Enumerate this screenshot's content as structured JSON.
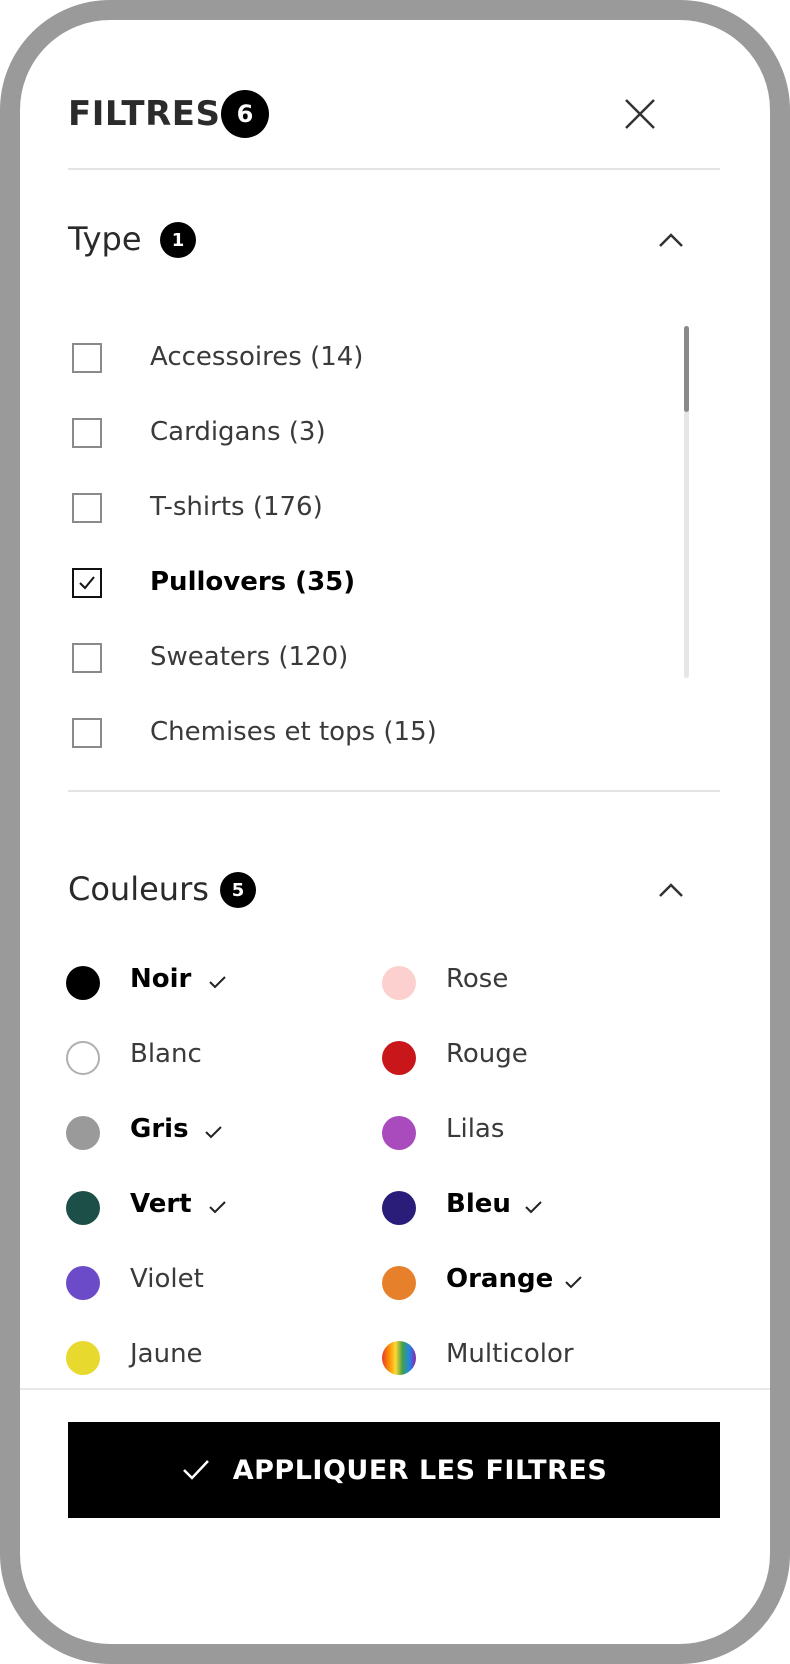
{
  "header": {
    "title": "FILTRES",
    "count": "6"
  },
  "type_section": {
    "title": "Type",
    "count": "1",
    "items": [
      {
        "label": "Accessoires (14)",
        "checked": false
      },
      {
        "label": "Cardigans (3)",
        "checked": false
      },
      {
        "label": "T-shirts (176)",
        "checked": false
      },
      {
        "label": "Pullovers (35)",
        "checked": true
      },
      {
        "label": "Sweaters (120)",
        "checked": false
      },
      {
        "label": "Chemises et tops (15)",
        "checked": false
      }
    ]
  },
  "colors_section": {
    "title": "Couleurs",
    "count": "5",
    "items": [
      {
        "label": "Noir",
        "color": "#000000",
        "selected": true
      },
      {
        "label": "Rose",
        "color": "#fdd0d0",
        "selected": false
      },
      {
        "label": "Blanc",
        "color": "#ffffff",
        "selected": false
      },
      {
        "label": "Rouge",
        "color": "#c8161b",
        "selected": false
      },
      {
        "label": "Gris",
        "color": "#9a9a9a",
        "selected": true
      },
      {
        "label": "Lilas",
        "color": "#a94bbd",
        "selected": false
      },
      {
        "label": "Vert",
        "color": "#1c4f48",
        "selected": true
      },
      {
        "label": "Bleu",
        "color": "#2a1d7a",
        "selected": true
      },
      {
        "label": "Violet",
        "color": "#6b4bc7",
        "selected": false
      },
      {
        "label": "Orange",
        "color": "#e7802a",
        "selected": true
      },
      {
        "label": "Jaune",
        "color": "#e8d92e",
        "selected": false
      },
      {
        "label": "Multicolor",
        "color": "multicolor",
        "selected": false
      }
    ]
  },
  "footer": {
    "apply_label": "APPLIQUER LES FILTRES"
  }
}
